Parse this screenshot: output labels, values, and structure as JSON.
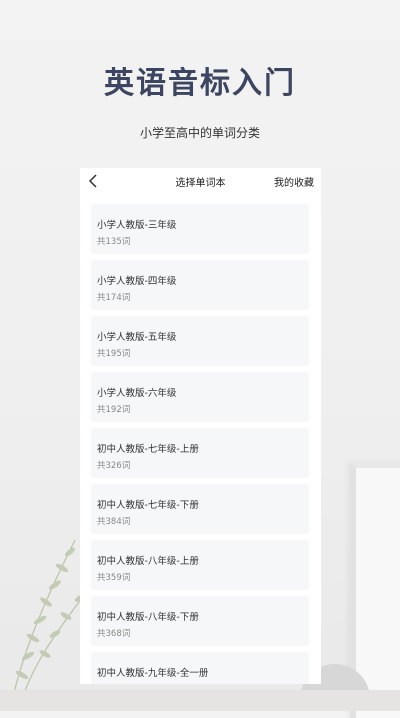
{
  "hero": {
    "title": "英语音标入门",
    "subtitle": "小学至高中的单词分类"
  },
  "topbar": {
    "back_icon": "chevron-left-icon",
    "title": "选择单词本",
    "action": "我的收藏"
  },
  "books": [
    {
      "name": "小学人教版-三年级",
      "count": "共135词"
    },
    {
      "name": "小学人教版-四年级",
      "count": "共174词"
    },
    {
      "name": "小学人教版-五年级",
      "count": "共195词"
    },
    {
      "name": "小学人教版-六年级",
      "count": "共192词"
    },
    {
      "name": "初中人教版-七年级-上册",
      "count": "共326词"
    },
    {
      "name": "初中人教版-七年级-下册",
      "count": "共384词"
    },
    {
      "name": "初中人教版-八年级-上册",
      "count": "共359词"
    },
    {
      "name": "初中人教版-八年级-下册",
      "count": "共368词"
    },
    {
      "name": "初中人教版-九年级-全一册",
      "count": ""
    }
  ],
  "colors": {
    "title": "#3d4660",
    "card_bg": "#f6f7f8"
  }
}
